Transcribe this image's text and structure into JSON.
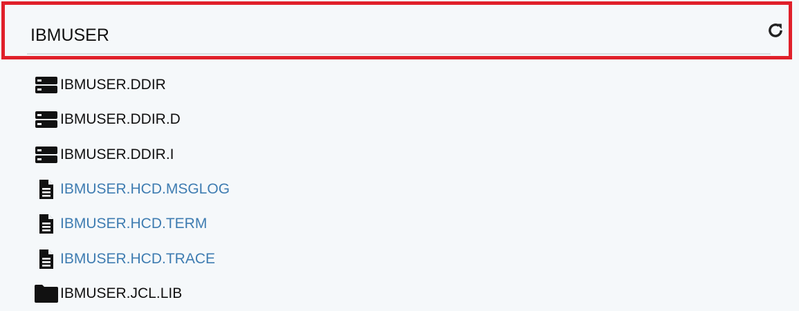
{
  "filter": {
    "value": "IBMUSER",
    "refresh_icon": "refresh-icon"
  },
  "colors": {
    "highlight_border": "#e0202a",
    "file_link": "#3e7cb1",
    "background": "#f5f8fa"
  },
  "tree": {
    "items": [
      {
        "label": "IBMUSER.DDIR",
        "icon": "server-icon",
        "kind": "dataset"
      },
      {
        "label": "IBMUSER.DDIR.D",
        "icon": "server-icon",
        "kind": "dataset"
      },
      {
        "label": "IBMUSER.DDIR.I",
        "icon": "server-icon",
        "kind": "dataset"
      },
      {
        "label": "IBMUSER.HCD.MSGLOG",
        "icon": "file-icon",
        "kind": "file"
      },
      {
        "label": "IBMUSER.HCD.TERM",
        "icon": "file-icon",
        "kind": "file"
      },
      {
        "label": "IBMUSER.HCD.TRACE",
        "icon": "file-icon",
        "kind": "file"
      },
      {
        "label": "IBMUSER.JCL.LIB",
        "icon": "folder-icon",
        "kind": "folder"
      }
    ]
  }
}
